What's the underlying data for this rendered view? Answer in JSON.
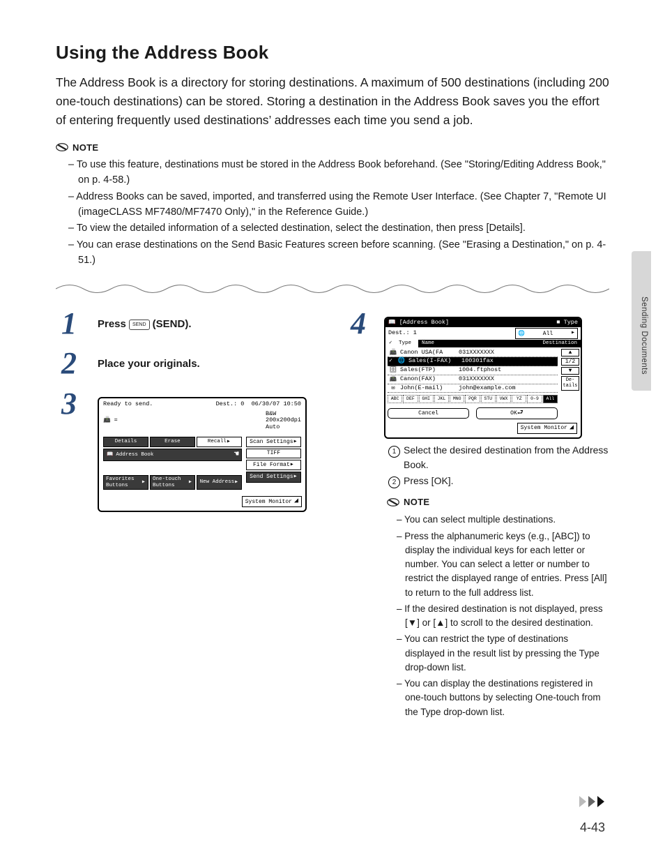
{
  "title": "Using the Address Book",
  "intro": "The Address Book is a directory for storing destinations. A maximum of 500 destinations (including 200 one-touch destinations) can be stored. Storing a destination in the Address Book saves you the effort of entering frequently used destinations’ addresses each time you send a job.",
  "note_label": "NOTE",
  "notes_top": [
    "To use this feature, destinations must be stored in the Address Book beforehand. (See \"Storing/Editing Address Book,\" on p. 4-58.)",
    "Address Books can be saved, imported, and transferred using the Remote User Interface. (See Chapter 7, \"Remote UI (imageCLASS MF7480/MF7470 Only),\" in the Reference Guide.)",
    "To view the detailed information of a selected destination, select the destination, then press [Details].",
    "You can erase destinations on the Send Basic Features screen before scanning. (See \"Erasing a Destination,\" on p. 4-51.)"
  ],
  "step_numbers": {
    "s1": "1",
    "s2": "2",
    "s3": "3",
    "s4": "4"
  },
  "steps": {
    "press_a": "Press ",
    "press_b": " (SEND).",
    "send_key_text": "SEND",
    "place_originals": "Place your originals."
  },
  "lcd_a": {
    "ready": "Ready to send.",
    "dest": "Dest.: 0",
    "datetime": "06/30/07 10:50",
    "mode": "B&W",
    "res": "200x200dpi",
    "auto": "Auto",
    "row1": [
      "Details",
      "Erase",
      "Recall"
    ],
    "address_book": "Address Book",
    "scan_settings": "Scan Settings",
    "tiff": "TIFF",
    "file_format": "File Format",
    "row_bottom": [
      "Favorites Buttons",
      "One-touch Buttons",
      "New Address",
      "Send Settings"
    ],
    "system_monitor": "System Monitor"
  },
  "lcd_b": {
    "title": "[Address Book]",
    "type_label": "Type",
    "type_value": "All",
    "dest": "Dest.: 1",
    "tab_type": "Type",
    "tab_name": "Name",
    "tab_dest": "Destination",
    "entries": [
      {
        "icon": "📠",
        "name": "Canon USA(FA",
        "dest": "031XXXXXXX"
      },
      {
        "icon": "🌐",
        "name": "Sales(I-FAX)",
        "dest": "100301fax",
        "selected": true
      },
      {
        "icon": "🗄",
        "name": "Sales(FTP)",
        "dest": "1004.ftphost"
      },
      {
        "icon": "📠",
        "name": "Canon(FAX)",
        "dest": "031XXXXXXX"
      },
      {
        "icon": "✉",
        "name": "John(E-mail)",
        "dest": "john@example.com"
      }
    ],
    "nav": {
      "up": "▲",
      "page": "1/2",
      "down": "▼",
      "details": "De- tails"
    },
    "letters": [
      "ABC",
      "DEF",
      "GHI",
      "JKL",
      "MNO",
      "PQR",
      "STU",
      "VWX",
      "YZ",
      "0-9",
      "All"
    ],
    "cancel": "Cancel",
    "ok": "OK",
    "system_monitor": "System Monitor"
  },
  "sub_steps": [
    "Select the desired destination from the Address Book.",
    "Press [OK]."
  ],
  "notes_bottom": [
    "You can select multiple destinations.",
    "Press the alphanumeric keys (e.g., [ABC]) to display the individual keys for each letter or number. You can select a letter or number to restrict the displayed range of entries. Press [All] to return to the full address list.",
    "If the desired destination is not displayed, press [▼] or [▲] to scroll to the desired destination.",
    "You can restrict the type of destinations displayed in the result list by pressing the Type drop-down list.",
    "You can display the destinations registered in one-touch buttons by selecting One-touch from the Type drop-down list."
  ],
  "side_tab_label": "Sending Documents",
  "page_number": "4-43"
}
